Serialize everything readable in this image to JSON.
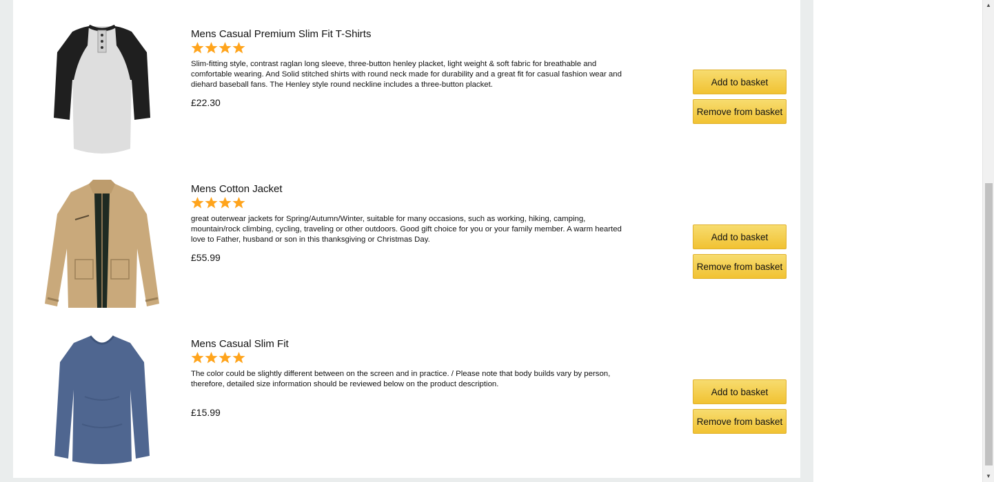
{
  "products": [
    {
      "title": "Mens Casual Premium Slim Fit T-Shirts",
      "rating_stars": 4,
      "description": "Slim-fitting style, contrast raglan long sleeve, three-button henley placket, light weight & soft fabric for breathable and comfortable wearing. And Solid stitched shirts with round neck made for durability and a great fit for casual fashion wear and diehard baseball fans. The Henley style round neckline includes a three-button placket.",
      "price": "£22.30",
      "add_label": "Add to basket",
      "remove_label": "Remove from basket",
      "image": "raglan-henley-tshirt"
    },
    {
      "title": "Mens Cotton Jacket",
      "rating_stars": 4,
      "description": "great outerwear jackets for Spring/Autumn/Winter, suitable for many occasions, such as working, hiking, camping, mountain/rock climbing, cycling, traveling or other outdoors. Good gift choice for you or your family member. A warm hearted love to Father, husband or son in this thanksgiving or Christmas Day.",
      "price": "£55.99",
      "add_label": "Add to basket",
      "remove_label": "Remove from basket",
      "image": "khaki-cotton-jacket"
    },
    {
      "title": "Mens Casual Slim Fit",
      "rating_stars": 4,
      "description": "The color could be slightly different between on the screen and in practice. / Please note that body builds vary by person, therefore, detailed size information should be reviewed below on the product description.",
      "price": "£15.99",
      "add_label": "Add to basket",
      "remove_label": "Remove from basket",
      "image": "blue-vneck-long-sleeve"
    }
  ],
  "colors": {
    "star": "#ffa41c",
    "button_top": "#f7dc6f",
    "button_bottom": "#f1c232",
    "page_background": "#eaeded"
  },
  "icons": {
    "rating": "star-icon",
    "scroll_up": "chevron-up-icon",
    "scroll_down": "chevron-down-icon"
  }
}
